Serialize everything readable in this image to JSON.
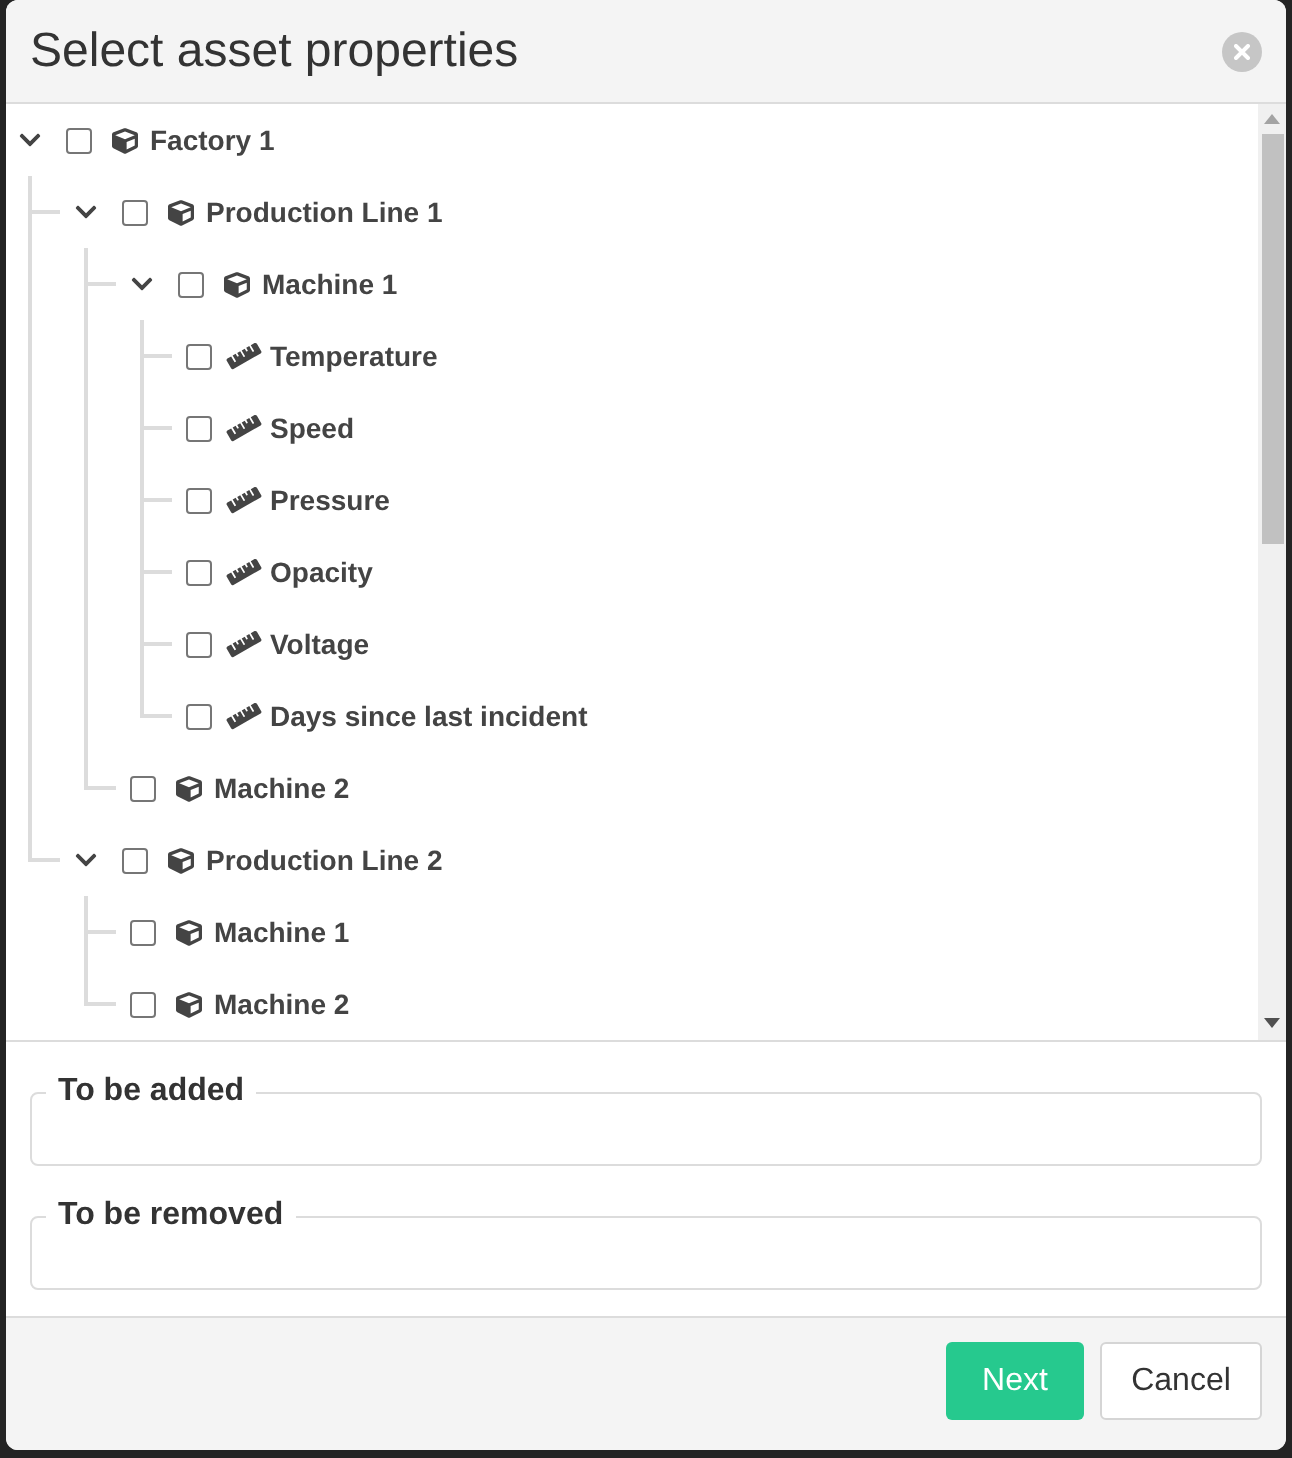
{
  "dialog": {
    "title": "Select asset properties"
  },
  "tree": [
    {
      "kind": "asset",
      "label": "Factory 1",
      "expanded": true,
      "checked": false,
      "children": [
        {
          "kind": "asset",
          "label": "Production Line 1",
          "expanded": true,
          "checked": false,
          "children": [
            {
              "kind": "asset",
              "label": "Machine 1",
              "expanded": true,
              "checked": false,
              "children": [
                {
                  "kind": "property",
                  "label": "Temperature",
                  "checked": false
                },
                {
                  "kind": "property",
                  "label": "Speed",
                  "checked": false
                },
                {
                  "kind": "property",
                  "label": "Pressure",
                  "checked": false
                },
                {
                  "kind": "property",
                  "label": "Opacity",
                  "checked": false
                },
                {
                  "kind": "property",
                  "label": "Voltage",
                  "checked": false
                },
                {
                  "kind": "property",
                  "label": "Days since last incident",
                  "checked": false
                }
              ]
            },
            {
              "kind": "asset",
              "label": "Machine 2",
              "checked": false
            }
          ]
        },
        {
          "kind": "asset",
          "label": "Production Line 2",
          "expanded": true,
          "checked": false,
          "children": [
            {
              "kind": "asset",
              "label": "Machine 1",
              "checked": false
            },
            {
              "kind": "asset",
              "label": "Machine 2",
              "checked": false
            }
          ]
        }
      ]
    }
  ],
  "fieldsets": [
    {
      "legend": "To be added"
    },
    {
      "legend": "To be removed"
    }
  ],
  "buttons": [
    {
      "label": "Next",
      "kind": "primary"
    },
    {
      "label": "Cancel",
      "kind": "secondary"
    }
  ]
}
